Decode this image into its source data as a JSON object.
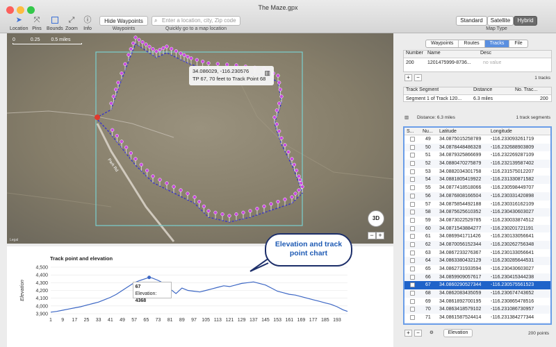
{
  "window": {
    "title": "The Maze.gpx",
    "traffic_colors": [
      "#fc605c",
      "#fdbc40",
      "#34c84a"
    ]
  },
  "toolbar": {
    "tools": [
      {
        "label": "Location",
        "icon": "location-arrow-icon"
      },
      {
        "label": "Pins",
        "icon": "pins-icon"
      },
      {
        "label": "Bounds",
        "icon": "bounds-icon"
      },
      {
        "label": "Zoom",
        "icon": "zoom-icon"
      },
      {
        "label": "Info",
        "icon": "info-icon"
      }
    ],
    "hide_waypoints_label": "Hide Waypoints",
    "waypoints_caption": "Waypoints",
    "search_placeholder": "Enter a location, city, Zip code",
    "search_caption": "Quickly go to a map location",
    "map_types": [
      "Standard",
      "Satellite",
      "Hybrid"
    ],
    "map_type_selected": "Hybrid",
    "map_type_caption": "Map Type"
  },
  "map": {
    "scale_labels": [
      "0",
      "0.25",
      "0.5 miles"
    ],
    "road_label": "Park Rd",
    "popup": {
      "coords": "34.086029, -116.230576",
      "detail": "TP 67, 70 feet to Track Point 68"
    },
    "btn_3d": "3D",
    "zoom_minus": "−",
    "zoom_plus": "+",
    "legal": "Legal"
  },
  "elevation_chart": {
    "title": "Track point and elevation",
    "callout": "Elevation and track point chart",
    "tooltip_point": "67",
    "tooltip_label": "Elevation:",
    "tooltip_value": "4368"
  },
  "chart_data": {
    "type": "line",
    "title": "Track point and elevation",
    "ylabel": "Elevation",
    "xlabel": "",
    "ylim": [
      3900,
      4500
    ],
    "y_ticks": [
      "3,900",
      "4,000",
      "4,100",
      "4,200",
      "4,300",
      "4,400",
      "4,500"
    ],
    "x_ticks": [
      "1",
      "9",
      "17",
      "25",
      "33",
      "41",
      "49",
      "57",
      "65",
      "73",
      "81",
      "89",
      "97",
      "105",
      "113",
      "121",
      "129",
      "137",
      "145",
      "153",
      "161",
      "169",
      "177",
      "185",
      "193"
    ],
    "series": [
      {
        "x": [
          1,
          5,
          9,
          13,
          17,
          21,
          25,
          29,
          33,
          37,
          41,
          45,
          49,
          53,
          57,
          61,
          65,
          67,
          69,
          73,
          77,
          81,
          85,
          89,
          93,
          97,
          101,
          105,
          109,
          113,
          117,
          121,
          125,
          129,
          133,
          137,
          141,
          145,
          149,
          153,
          157,
          161,
          165,
          169,
          173,
          177,
          181,
          185,
          189,
          193,
          197,
          200
        ],
        "y": [
          3920,
          3930,
          3945,
          3960,
          3975,
          3990,
          4010,
          4030,
          4050,
          4080,
          4110,
          4150,
          4200,
          4250,
          4300,
          4330,
          4355,
          4368,
          4360,
          4330,
          4290,
          4220,
          4160,
          4230,
          4200,
          4190,
          4180,
          4200,
          4220,
          4240,
          4260,
          4250,
          4270,
          4290,
          4300,
          4310,
          4290,
          4270,
          4230,
          4190,
          4170,
          4150,
          4140,
          4120,
          4100,
          4080,
          4060,
          4040,
          4020,
          3990,
          3950,
          3930
        ]
      }
    ],
    "grid": true,
    "line_color": "#3b66c4",
    "highlight": {
      "x": 67,
      "y": 4368
    }
  },
  "sidebar": {
    "tabs": [
      "Waypoints",
      "Routes",
      "Tracks",
      "File"
    ],
    "active_tab": "Tracks",
    "tracks_table": {
      "headers": [
        "Number",
        "Name",
        "Desc"
      ],
      "rows": [
        [
          "200",
          "1201475999-8736...",
          "no value"
        ]
      ]
    },
    "tracks_count": "1 tracks",
    "segments_table": {
      "headers": [
        "Track Segment",
        "Distance",
        "No. Trac..."
      ],
      "rows": [
        [
          "Segment 1 of Track 120...",
          "6.3 miles",
          "200"
        ]
      ]
    },
    "distance": "Distance: 6.3 miles",
    "segments_count": "1 track segments",
    "points_headers": [
      "S...",
      "Nu...",
      "Latitude",
      "Longitude"
    ],
    "points": [
      [
        "49",
        "34.0875015258789",
        "-116.233093261719"
      ],
      [
        "50",
        "34.0878448486328",
        "-116.232688903809"
      ],
      [
        "51",
        "34.0879325866699",
        "-116.232269287109"
      ],
      [
        "52",
        "34.0880470275879",
        "-116.232139587402"
      ],
      [
        "53",
        "34.0882034301758",
        "-116.231575012207"
      ],
      [
        "54",
        "34.0881805419922",
        "-116.231330871582"
      ],
      [
        "55",
        "34.0877418518066",
        "-116.230598449707"
      ],
      [
        "56",
        "34.0876808166504",
        "-116.230331420898"
      ],
      [
        "57",
        "34.0875854492188",
        "-116.230316162109"
      ],
      [
        "58",
        "34.0875625610352",
        "-116.230430603027"
      ],
      [
        "59",
        "34.0873022529785",
        "-116.230033874512"
      ],
      [
        "60",
        "34.0871543884277",
        "-116.230201721191"
      ],
      [
        "61",
        "34.0869941711426",
        "-116.230133056641"
      ],
      [
        "62",
        "34.0870056152344",
        "-116.230262756348"
      ],
      [
        "63",
        "34.0867233276367",
        "-116.230133056641"
      ],
      [
        "64",
        "34.0863380432129",
        "-116.230285644531"
      ],
      [
        "65",
        "34.0862731933594",
        "-116.230430603027"
      ],
      [
        "66",
        "34.0859909057617",
        "-116.230415344238"
      ],
      [
        "67",
        "34.0860290527344",
        "-116.230575561523"
      ],
      [
        "68",
        "34.0862083435059",
        "-116.230674743652"
      ],
      [
        "69",
        "34.0861892700195",
        "-116.230865478516"
      ],
      [
        "70",
        "34.0863418579102",
        "-116.231086730957"
      ],
      [
        "71",
        "34.0861587524414",
        "-116.231384277344"
      ],
      [
        "72",
        "34.0863571166992",
        "-116.231101989746"
      ],
      [
        "73",
        "34.0861930847168",
        "-116.230804443359"
      ],
      [
        "74",
        "34.0862426757812",
        "-116.230712890625"
      ]
    ],
    "selected_point": "67",
    "elevation_button": "Elevation",
    "points_count": "200 points"
  }
}
